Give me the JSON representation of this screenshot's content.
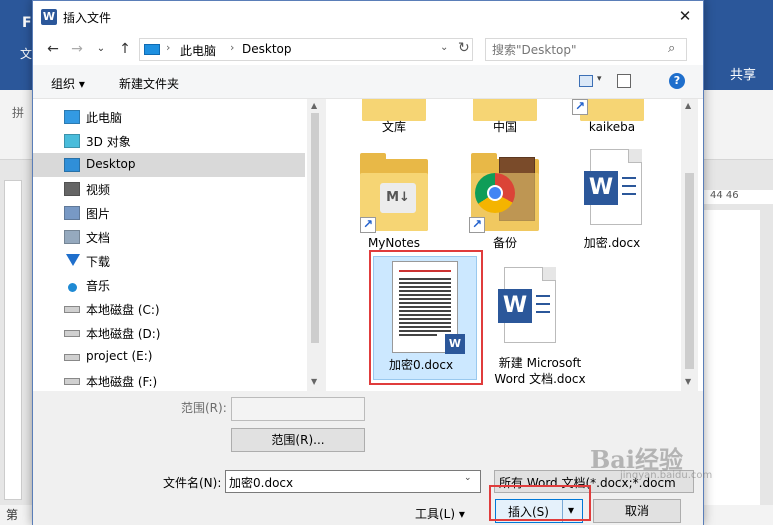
{
  "background_word": {
    "share_label": "共享",
    "left_fe": "F",
    "left_wen": "文",
    "left_pin": "拼",
    "ruler_num": "44  46",
    "status_left": "第"
  },
  "dialog": {
    "title": "插入文件",
    "close_glyph": "✕",
    "nav": {
      "back": "←",
      "forward": "→",
      "recent": "⌄",
      "up": "↑",
      "breadcrumb_sep": "›",
      "breadcrumb_pc": "此电脑",
      "breadcrumb_desktop": "Desktop",
      "address_dropdown": "⌄",
      "refresh": "↻",
      "search_placeholder": "搜索\"Desktop\"",
      "search_glyph": "⌕"
    },
    "toolbar": {
      "organize_label": "组织 ▾",
      "newfolder_label": "新建文件夹",
      "view_dropdown": "▾",
      "help_label": "?"
    },
    "tree": [
      {
        "label": "此电脑",
        "icon": "computer-icon"
      },
      {
        "label": "3D 对象",
        "icon": "cube-3d-icon"
      },
      {
        "label": "Desktop",
        "icon": "desktop-icon",
        "selected": true
      },
      {
        "label": "视频",
        "icon": "video-icon"
      },
      {
        "label": "图片",
        "icon": "picture-icon"
      },
      {
        "label": "文档",
        "icon": "document-icon"
      },
      {
        "label": "下载",
        "icon": "download-icon"
      },
      {
        "label": "音乐",
        "icon": "music-icon"
      },
      {
        "label": "本地磁盘 (C:)",
        "icon": "drive-icon"
      },
      {
        "label": "本地磁盘 (D:)",
        "icon": "drive-icon"
      },
      {
        "label": "project (E:)",
        "icon": "drive-icon"
      },
      {
        "label": "本地磁盘 (F:)",
        "icon": "drive-icon"
      }
    ],
    "files": {
      "wenku": "文库",
      "zhongguo": "中国",
      "kaikeba": "kaikeba",
      "mynotes": "MyNotes",
      "beifen": "备份",
      "jiami": "加密.docx",
      "jiami0": "加密0.docx",
      "xinjian": "新建 Microsoft Word 文档.docx"
    },
    "scroll_up": "▲",
    "scroll_down": "▼",
    "word_glyph": "W",
    "md_glyph": "M↓",
    "shortcut_glyph": "↗",
    "bottom": {
      "range_label": "范围(R):",
      "range_button": "范围(R)...",
      "filename_label": "文件名(N):",
      "filename_value": "加密0.docx",
      "filename_dropdown": "⌄",
      "filetype_value": "所有 Word 文档(*.docx;*.docm",
      "tools_label": "工具(L)   ▾",
      "insert_label": "插入(S)",
      "insert_dropdown": "▾",
      "cancel_label": "取消"
    }
  },
  "watermark": {
    "main": "Bai经验",
    "sub": "jingyan.baidu.com"
  },
  "colors": {
    "word_blue": "#2b579a",
    "selection": "#cce8ff",
    "highlight_red": "#e03c3c",
    "folder": "#e8b847"
  }
}
